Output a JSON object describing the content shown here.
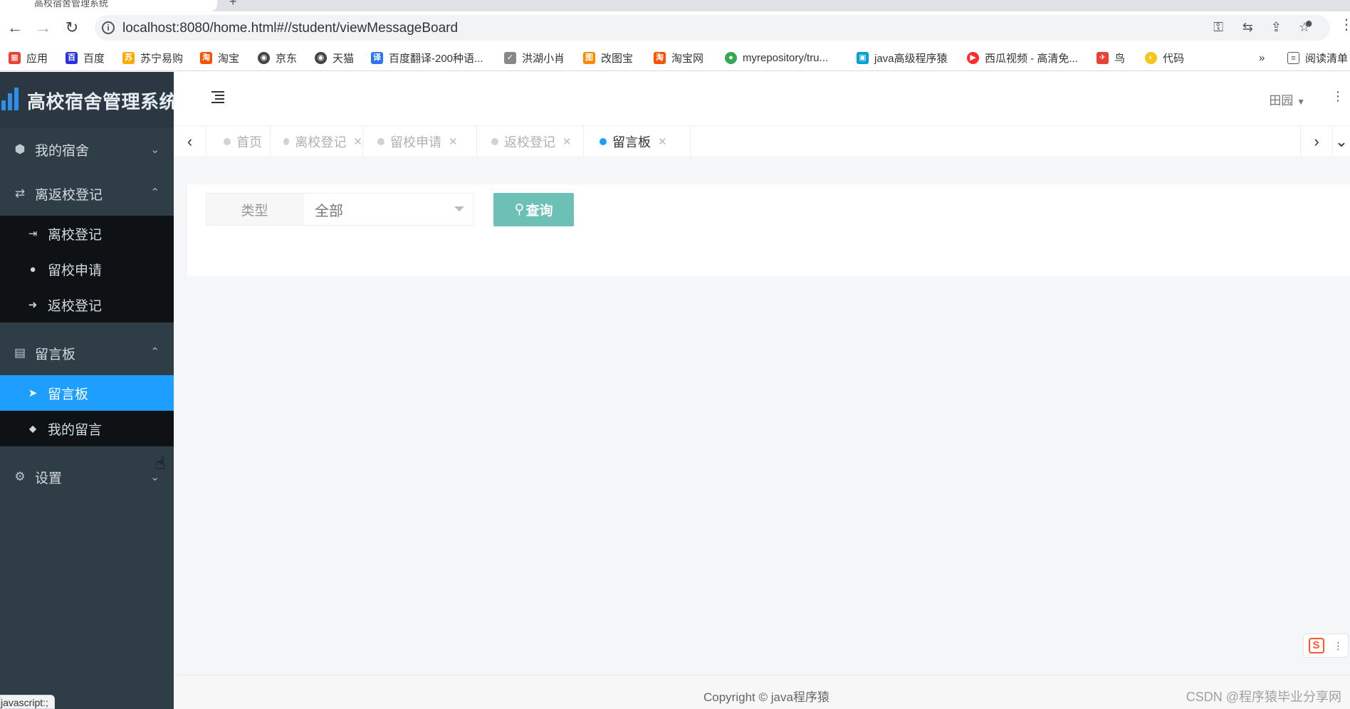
{
  "browser": {
    "tab_title": "高校宿舍管理系统",
    "url": "localhost:8080/home.html#//student/viewMessageBoard",
    "bookmarks": [
      {
        "label": "应用",
        "color": "#e94235"
      },
      {
        "label": "百度",
        "color": "#2932e1"
      },
      {
        "label": "苏宁易购",
        "color": "#ffaa00"
      },
      {
        "label": "淘宝",
        "color": "#ff5000"
      },
      {
        "label": "京东",
        "color": "#444444"
      },
      {
        "label": "天猫",
        "color": "#444444"
      },
      {
        "label": "百度翻译-200种语...",
        "color": "#2c73f6"
      },
      {
        "label": "洪湖小肖",
        "color": "#888888"
      },
      {
        "label": "改图宝",
        "color": "#ff8a00"
      },
      {
        "label": "淘宝网",
        "color": "#ff5000"
      },
      {
        "label": "myrepository/tru...",
        "color": "#34a853"
      },
      {
        "label": "java高级程序猿",
        "color": "#00a1d6"
      },
      {
        "label": "西瓜视频 - 高清免...",
        "color": "#ff2c2c"
      },
      {
        "label": "鸟",
        "color": "#e94235"
      },
      {
        "label": "代码",
        "color": "#f5c518"
      }
    ],
    "more": "»",
    "reading_list": "阅读清单",
    "status_text": "javascript:;"
  },
  "app": {
    "title": "高校宿舍管理系统",
    "user": "田园"
  },
  "sidebar": {
    "groups": [
      {
        "label": "我的宿舍",
        "icon": "cube-icon",
        "expanded": false
      },
      {
        "label": "离返校登记",
        "icon": "exchange-icon",
        "expanded": true
      },
      {
        "label": "留言板",
        "icon": "calendar-icon",
        "expanded": true
      },
      {
        "label": "设置",
        "icon": "gear-icon",
        "expanded": false
      }
    ],
    "sub_leave": [
      {
        "label": "离校登记",
        "icon": "sign-out-icon"
      },
      {
        "label": "留校申请",
        "icon": "globe-icon"
      },
      {
        "label": "返校登记",
        "icon": "sign-in-icon"
      }
    ],
    "sub_board": [
      {
        "label": "留言板",
        "icon": "paper-plane-icon",
        "active": true
      },
      {
        "label": "我的留言",
        "icon": "tags-icon",
        "active": false
      }
    ]
  },
  "page_tabs": [
    {
      "label": "首页",
      "closable": false
    },
    {
      "label": "离校登记",
      "closable": true
    },
    {
      "label": "留校申请",
      "closable": true
    },
    {
      "label": "返校登记",
      "closable": true
    },
    {
      "label": "留言板",
      "closable": true,
      "active": true
    }
  ],
  "filter": {
    "type_label": "类型",
    "type_value": "全部",
    "query_button": "查询"
  },
  "footer": {
    "copyright": "Copyright © java程序猿",
    "watermark": "CSDN @程序猿毕业分享网"
  },
  "colors": {
    "sidebar_bg": "#2f3d47",
    "submenu_bg": "#0e1215",
    "active_item": "#1e9fff",
    "query_button": "#6cc0b6"
  }
}
